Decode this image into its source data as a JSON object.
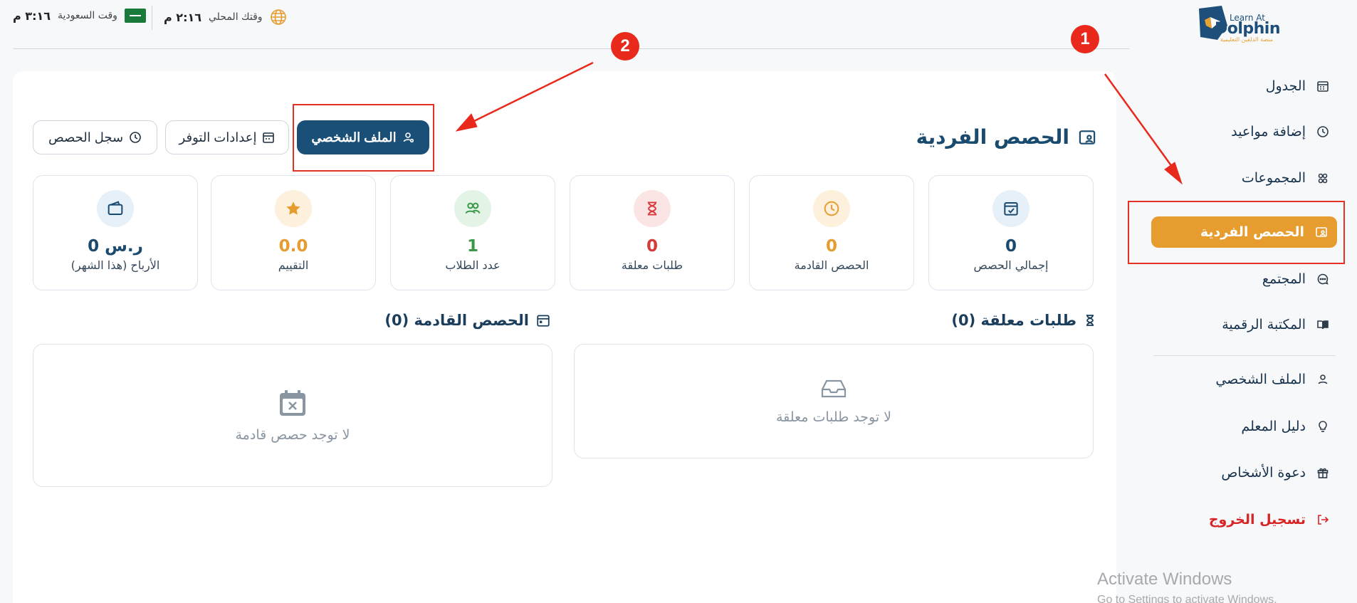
{
  "brand": {
    "line1": "Learn At",
    "line2": "Dolphin",
    "line3": "منصة الدلفين التعليمية"
  },
  "topbar": {
    "local_label": "وقتك المحلي",
    "local_time": "٢:١٦ م",
    "saudi_label": "وقت السعودية",
    "saudi_time": "٣:١٦ م"
  },
  "sidebar": {
    "items": [
      {
        "label": "الجدول",
        "icon": "calendar-grid-icon"
      },
      {
        "label": "إضافة مواعيد",
        "icon": "clock-icon"
      },
      {
        "label": "المجموعات",
        "icon": "group-icon"
      },
      {
        "label": "الحصص الفردية",
        "icon": "person-board-icon",
        "active": true
      },
      {
        "label": "المجتمع",
        "icon": "chat-icon"
      },
      {
        "label": "المكتبة الرقمية",
        "icon": "book-icon"
      },
      {
        "label": "الملف الشخصي",
        "icon": "user-icon"
      },
      {
        "label": "دليل المعلم",
        "icon": "lightbulb-icon"
      },
      {
        "label": "دعوة الأشخاص",
        "icon": "gift-icon"
      },
      {
        "label": "تسجيل الخروج",
        "icon": "logout-icon"
      }
    ]
  },
  "main": {
    "title": "الحصص الفردية",
    "buttons": {
      "profile": "الملف الشخصي",
      "availability": "إعدادات التوفر",
      "history": "سجل الحصص"
    },
    "stats": [
      {
        "label": "إجمالي الحصص",
        "value": "0",
        "color": "#1a4a6e",
        "bg": "#e6f0f8",
        "icon": "calendar-check-icon"
      },
      {
        "label": "الحصص القادمة",
        "value": "0",
        "color": "#e69c2f",
        "bg": "#fdf0dd",
        "icon": "clock-icon"
      },
      {
        "label": "طلبات معلقة",
        "value": "0",
        "color": "#d63a3a",
        "bg": "#fbe4e4",
        "icon": "hourglass-icon"
      },
      {
        "label": "عدد الطلاب",
        "value": "1",
        "color": "#3a9a4a",
        "bg": "#e3f3e6",
        "icon": "users-icon"
      },
      {
        "label": "التقييم",
        "value": "0.0",
        "color": "#e69c2f",
        "bg": "#fdf0dd",
        "icon": "star-icon"
      },
      {
        "label": "الأرباح (هذا الشهر)",
        "value": "0 ر.س",
        "color": "#1a4a6e",
        "bg": "#e6f0f8",
        "icon": "wallet-icon"
      }
    ],
    "pending": {
      "title": "طلبات معلقة (0)",
      "empty": "لا توجد طلبات معلقة"
    },
    "upcoming": {
      "title": "الحصص القادمة (0)",
      "empty": "لا توجد حصص قادمة"
    }
  },
  "annotations": {
    "badge1": "1",
    "badge2": "2"
  },
  "watermark": {
    "line1": "Activate Windows",
    "line2": "Go to Settings to activate Windows."
  },
  "colors": {
    "accent": "#e69c2f",
    "primary": "#1a4f78",
    "danger": "#d62525",
    "annotation": "#e53024"
  }
}
